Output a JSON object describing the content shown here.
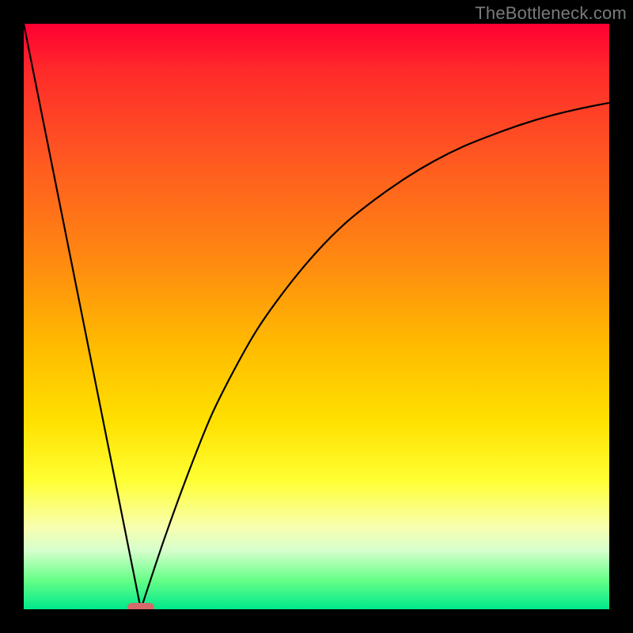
{
  "watermark": "TheBottleneck.com",
  "chart_data": {
    "type": "line",
    "title": "",
    "xlabel": "",
    "ylabel": "",
    "xlim": [
      0,
      100
    ],
    "ylim": [
      0,
      100
    ],
    "series": [
      {
        "name": "left-segment",
        "x": [
          0,
          20
        ],
        "y": [
          100,
          0
        ]
      },
      {
        "name": "right-curve",
        "x": [
          20,
          24,
          28,
          32,
          36,
          40,
          45,
          50,
          55,
          60,
          65,
          70,
          75,
          80,
          85,
          90,
          95,
          100
        ],
        "y": [
          0,
          12,
          23,
          33,
          41,
          48,
          55,
          61,
          66,
          70,
          73.5,
          76.5,
          79,
          81,
          82.8,
          84.3,
          85.5,
          86.5
        ]
      }
    ],
    "marker": {
      "x": 20,
      "y": 0,
      "shape": "rounded-rect",
      "color": "#d66a6a"
    },
    "background_gradient": {
      "direction": "vertical",
      "stops": [
        {
          "pos": 0.0,
          "color": "#ff0033"
        },
        {
          "pos": 0.4,
          "color": "#ff8811"
        },
        {
          "pos": 0.7,
          "color": "#ffe100"
        },
        {
          "pos": 0.88,
          "color": "#f8ffb0"
        },
        {
          "pos": 1.0,
          "color": "#00e88a"
        }
      ]
    }
  }
}
